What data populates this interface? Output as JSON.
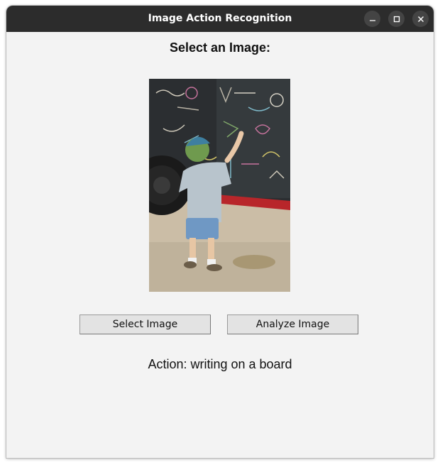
{
  "window": {
    "title": "Image Action Recognition"
  },
  "main": {
    "heading": "Select an Image:",
    "select_button_label": "Select Image",
    "analyze_button_label": "Analyze Image",
    "result_text": "Action: writing on a board"
  },
  "icons": {
    "minimize": "minimize-icon",
    "maximize": "maximize-icon",
    "close": "close-icon"
  },
  "colors": {
    "titlebar": "#2c2c2c",
    "window_bg": "#f3f3f3",
    "button_bg": "#e3e3e3"
  }
}
